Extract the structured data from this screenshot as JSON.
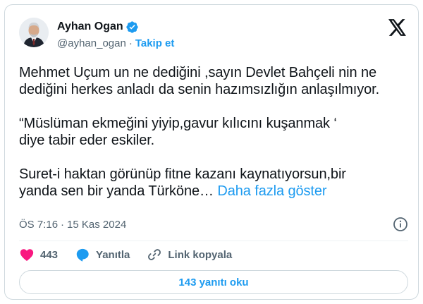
{
  "author": {
    "display_name": "Ayhan Ogan",
    "handle": "@ayhan_ogan",
    "separator": "·",
    "follow_label": "Takip et"
  },
  "tweet": {
    "paragraphs": [
      [
        "Mehmet Uçum un ne dediğini ,sayın Devlet Bahçeli nin ne",
        "dediğini herkes anladı da senin hazımsızlığın anlaşılmıyor."
      ],
      [
        "“Müslüman ekmeğini yiyip,gavur kılıcını kuşanmak ‘",
        "diye tabir eder eskiler."
      ],
      [
        "Suret-i haktan görünüp fitne kazanı kaynatıyorsun,bir",
        "yanda sen bir yanda Türköne…"
      ]
    ],
    "show_more_label": "Daha fazla göster"
  },
  "meta": {
    "time": "ÖS 7:16",
    "separator": "·",
    "date": "15 Kas 2024"
  },
  "actions": {
    "like_count": "443",
    "reply_label": "Yanıtla",
    "copy_link_label": "Link kopyala"
  },
  "read_replies_label": "143 yanıtı oku",
  "colors": {
    "accent": "#1d9bf0",
    "like": "#f91880",
    "text": "#0f1419",
    "muted": "#536471",
    "border": "#cfd9de"
  },
  "icons": [
    "verified-badge-icon",
    "x-logo-icon",
    "info-icon",
    "heart-icon",
    "reply-bubble-icon",
    "link-icon"
  ]
}
